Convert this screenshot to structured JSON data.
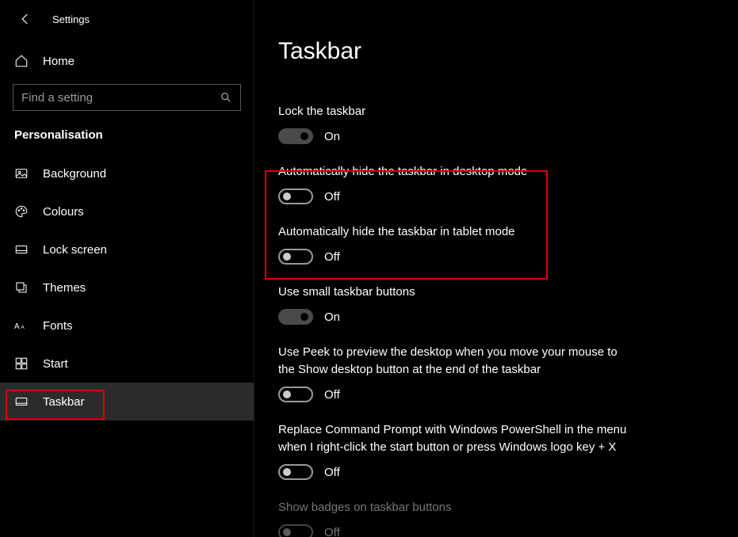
{
  "app_title": "Settings",
  "home_label": "Home",
  "search": {
    "placeholder": "Find a setting"
  },
  "category_title": "Personalisation",
  "sidebar": {
    "items": [
      {
        "label": "Background"
      },
      {
        "label": "Colours"
      },
      {
        "label": "Lock screen"
      },
      {
        "label": "Themes"
      },
      {
        "label": "Fonts"
      },
      {
        "label": "Start"
      },
      {
        "label": "Taskbar"
      }
    ]
  },
  "page_title": "Taskbar",
  "toggle_states": {
    "on": "On",
    "off": "Off"
  },
  "settings": [
    {
      "label": "Lock the taskbar",
      "value": true
    },
    {
      "label": "Automatically hide the taskbar in desktop mode",
      "value": false
    },
    {
      "label": "Automatically hide the taskbar in tablet mode",
      "value": false
    },
    {
      "label": "Use small taskbar buttons",
      "value": true
    },
    {
      "label": "Use Peek to preview the desktop when you move your mouse to the Show desktop button at the end of the taskbar",
      "value": false
    },
    {
      "label": "Replace Command Prompt with Windows PowerShell in the menu when I right-click the start button or press Windows logo key + X",
      "value": false
    },
    {
      "label": "Show badges on taskbar buttons",
      "value": false,
      "disabled": true
    }
  ]
}
